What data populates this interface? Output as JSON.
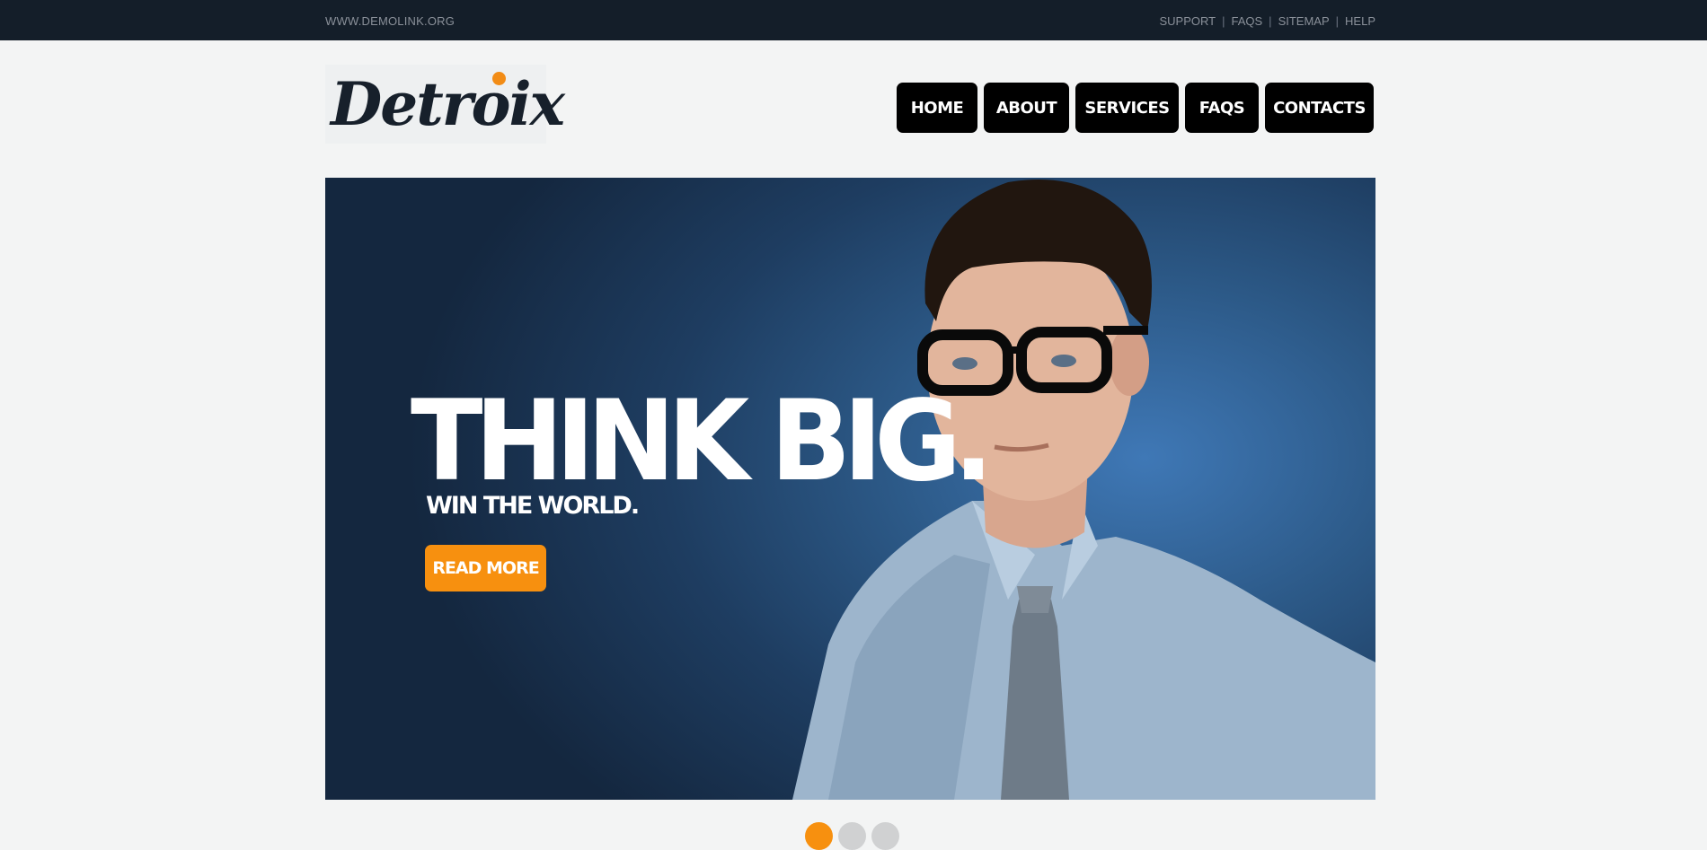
{
  "topbar": {
    "site_url": "WWW.DEMOLINK.ORG",
    "links": [
      "SUPPORT",
      "FAQS",
      "SITEMAP",
      "HELP"
    ]
  },
  "logo": {
    "text": "Detroix"
  },
  "nav": {
    "items": [
      "HOME",
      "ABOUT",
      "SERVICES",
      "FAQS",
      "CONTACTS"
    ]
  },
  "slider": {
    "headline": "THINK BIG.",
    "subhead": "WIN THE WORLD.",
    "cta_label": "READ MORE",
    "active_slide": 1,
    "slide_count": 3
  },
  "colors": {
    "topbar_bg": "#141e29",
    "accent": "#f7900f",
    "nav_bg": "#000000",
    "page_bg": "#f3f4f4"
  }
}
